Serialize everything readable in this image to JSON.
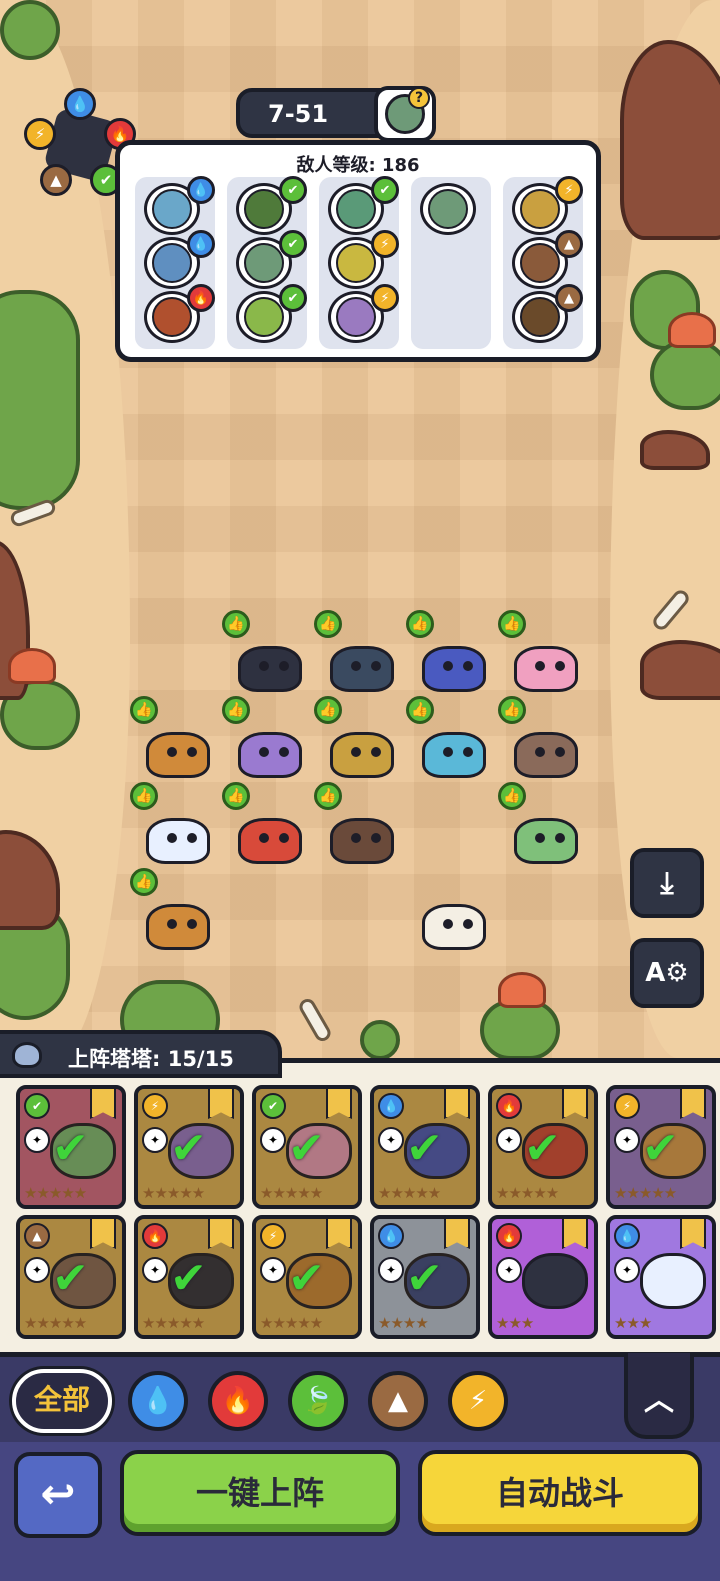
{
  "stage": {
    "label": "7-51"
  },
  "enemy_panel": {
    "level_label": "敌人等级: 186",
    "columns": [
      [
        {
          "element": "water",
          "color": "#6aa7c9"
        },
        {
          "element": "water",
          "color": "#5f8fc0"
        },
        {
          "element": "fire",
          "color": "#b0502e"
        }
      ],
      [
        {
          "element": "grass",
          "color": "#4f7a3a"
        },
        {
          "element": "grass",
          "color": "#6e9a78"
        },
        {
          "element": "grass",
          "color": "#8ab84a"
        }
      ],
      [
        {
          "element": "grass",
          "color": "#5a9a78"
        },
        {
          "element": "thunder",
          "color": "#c9b840"
        },
        {
          "element": "thunder",
          "color": "#9a7ac0"
        }
      ],
      [
        {
          "element": "none",
          "color": "#6e9a78"
        }
      ],
      [
        {
          "element": "thunder",
          "color": "#c9a040"
        },
        {
          "element": "earth",
          "color": "#8a5a3a"
        },
        {
          "element": "earth",
          "color": "#6a4a2a"
        }
      ]
    ]
  },
  "team": {
    "label": "上阵塔塔: 15/15"
  },
  "side_buttons": {
    "download_icon": "⤓",
    "auto_settings": "A⚙"
  },
  "cards": [
    {
      "element": "grass",
      "bg": "#d96a8a",
      "pet": "#7fc07a",
      "stars": "★★★★★",
      "checked": true
    },
    {
      "element": "thunder",
      "bg": "#e6b85a",
      "pet": "#9a7ad0",
      "stars": "★★★★★",
      "checked": true
    },
    {
      "element": "grass",
      "bg": "#e6b85a",
      "pet": "#f0a0c0",
      "stars": "★★★★★",
      "checked": true
    },
    {
      "element": "water",
      "bg": "#e6b85a",
      "pet": "#4a5ac0",
      "stars": "★★★★★",
      "checked": true
    },
    {
      "element": "fire",
      "bg": "#e6b85a",
      "pet": "#d84a3a",
      "stars": "★★★★★",
      "checked": true
    },
    {
      "element": "thunder",
      "bg": "#9a7ad0",
      "pet": "#e0a050",
      "stars": "★★★★★",
      "checked": true
    },
    {
      "element": "earth",
      "bg": "#e6b85a",
      "pet": "#8a6a5a",
      "stars": "★★★★★",
      "checked": true
    },
    {
      "element": "fire",
      "bg": "#e6b85a",
      "pet": "#2e3140",
      "stars": "★★★★★",
      "checked": true
    },
    {
      "element": "thunder",
      "bg": "#e6b85a",
      "pet": "#d08a3a",
      "stars": "★★★★★",
      "checked": true
    },
    {
      "element": "water",
      "bg": "#b8c8e0",
      "pet": "#3a4a8a",
      "stars": "★★★★",
      "checked": true
    },
    {
      "element": "fire",
      "bg": "#b060d8",
      "pet": "#2e3140",
      "stars": "★★★",
      "checked": false
    },
    {
      "element": "water",
      "bg": "#a078e0",
      "pet": "#e8f0ff",
      "stars": "★★★",
      "checked": false
    }
  ],
  "filters": {
    "all_label": "全部",
    "items": [
      {
        "name": "water",
        "glyph": "💧",
        "color": "#3f8de6"
      },
      {
        "name": "fire",
        "glyph": "🔥",
        "color": "#e23a3a"
      },
      {
        "name": "grass",
        "glyph": "🍃",
        "color": "#5cbf3a"
      },
      {
        "name": "earth",
        "glyph": "▲",
        "color": "#9a6a42"
      },
      {
        "name": "thunder",
        "glyph": "⚡",
        "color": "#f2b42a"
      }
    ],
    "collapse_icon": "︿"
  },
  "buttons": {
    "back_icon": "↩",
    "deploy_label": "一键上阵",
    "auto_battle_label": "自动战斗"
  }
}
